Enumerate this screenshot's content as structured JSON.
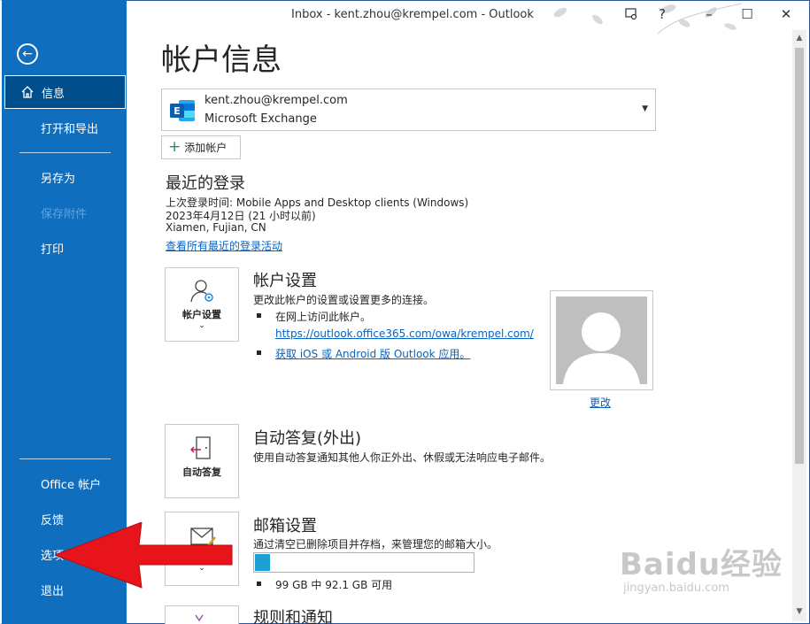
{
  "window": {
    "title": "Inbox - kent.zhou@krempel.com  -  Outlook",
    "controls": [
      "minimize-icon",
      "maximize-icon",
      "close-icon"
    ]
  },
  "sidebar": {
    "items": [
      {
        "label": "信息",
        "state": "active"
      },
      {
        "label": "打开和导出"
      },
      {
        "label": "另存为"
      },
      {
        "label": "保存附件",
        "state": "disabled"
      },
      {
        "label": "打印"
      },
      {
        "label": "Office 帐户"
      },
      {
        "label": "反馈"
      },
      {
        "label": "选项"
      },
      {
        "label": "退出"
      }
    ]
  },
  "main": {
    "title": "帐户信息",
    "account": {
      "email": "kent.zhou@krempel.com",
      "type": "Microsoft Exchange"
    },
    "add_account_label": "添加帐户",
    "recent_login": {
      "title": "最近的登录",
      "line1": "上次登录时间: Mobile Apps and Desktop clients (Windows)",
      "line2": "2023年4月12日 (21 小时以前)",
      "line3": "Xiamen, Fujian, CN",
      "link": "查看所有最近的登录活动"
    },
    "account_settings": {
      "tile_label": "帐户设置",
      "title": "帐户设置",
      "desc": "更改此帐户的设置或设置更多的连接。",
      "bullet1": "在网上访问此帐户。",
      "url": "https://outlook.office365.com/owa/krempel.com/",
      "bullet2_link": "获取 iOS 或 Android 版 Outlook 应用。"
    },
    "profile_photo": {
      "change_label": "更改"
    },
    "auto_reply": {
      "tile_label": "自动答复",
      "title": "自动答复(外出)",
      "desc": "使用自动答复通知其他人你正外出、休假或无法响应电子邮件。"
    },
    "mailbox_settings": {
      "title": "邮箱设置",
      "desc": "通过清空已删除项目并存档，来管理您的邮箱大小。",
      "usage_fraction": 0.07,
      "usage_text": "99 GB 中 92.1 GB 可用"
    },
    "rules": {
      "title": "规则和通知"
    }
  },
  "colors": {
    "sidebar": "#106ebe",
    "sidebar_active": "#004e8c",
    "link": "#0563c1",
    "storage_fill": "#1ea0d6",
    "arrow": "#e8141b"
  },
  "watermark": {
    "main": "Baidu经验",
    "sub": "jingyan.baidu.com"
  }
}
